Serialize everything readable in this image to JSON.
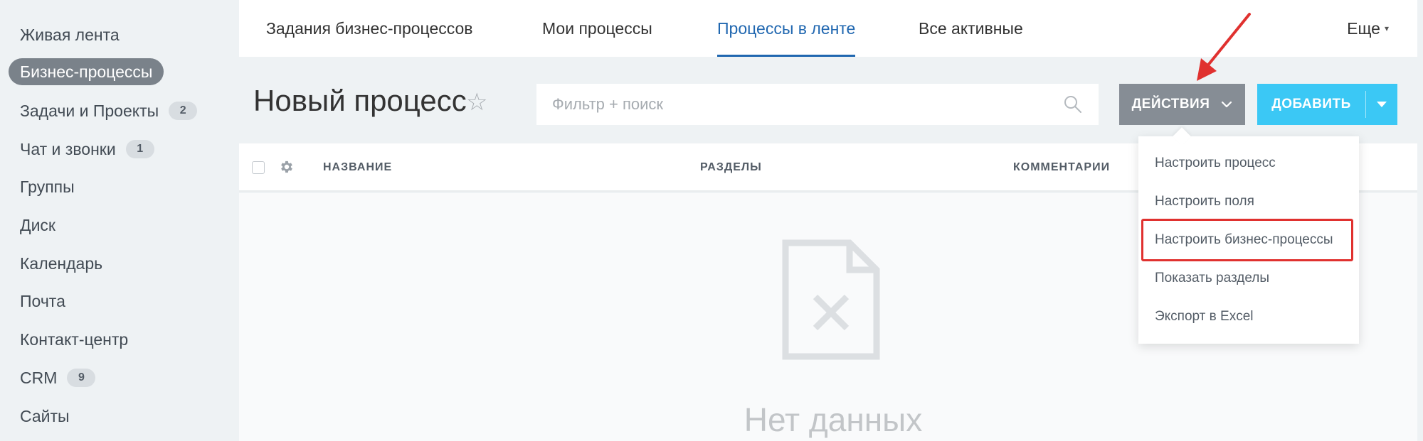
{
  "sidebar": {
    "items": [
      {
        "label": "Живая лента"
      },
      {
        "label": "Бизнес-процессы"
      },
      {
        "label": "Задачи и Проекты",
        "badge": "2"
      },
      {
        "label": "Чат и звонки",
        "badge": "1"
      },
      {
        "label": "Группы"
      },
      {
        "label": "Диск"
      },
      {
        "label": "Календарь"
      },
      {
        "label": "Почта"
      },
      {
        "label": "Контакт-центр"
      },
      {
        "label": "CRM",
        "badge": "9"
      },
      {
        "label": "Сайты"
      }
    ]
  },
  "topnav": {
    "tabs": [
      {
        "label": "Задания бизнес-процессов"
      },
      {
        "label": "Мои процессы"
      },
      {
        "label": "Процессы в ленте"
      },
      {
        "label": "Все активные"
      }
    ],
    "more_label": "Еще"
  },
  "header": {
    "title": "Новый процесс",
    "star": "☆"
  },
  "search": {
    "placeholder": "Фильтр + поиск"
  },
  "actions_button": {
    "label": "ДЕЙСТВИЯ"
  },
  "add_button": {
    "label": "ДОБАВИТЬ"
  },
  "table": {
    "columns": [
      "НАЗВАНИЕ",
      "РАЗДЕЛЫ",
      "КОММЕНТАРИИ"
    ],
    "empty_text": "Нет данных"
  },
  "dropdown": {
    "items": [
      {
        "label": "Настроить процесс"
      },
      {
        "label": "Настроить поля"
      },
      {
        "label": "Настроить бизнес-процессы"
      },
      {
        "label": "Показать разделы"
      },
      {
        "label": "Экспорт в Excel"
      }
    ]
  },
  "colors": {
    "active_tab": "#2067b0",
    "actions_button": "#868d95",
    "add_button": "#3bc8f5",
    "highlight": "#e0312f"
  }
}
